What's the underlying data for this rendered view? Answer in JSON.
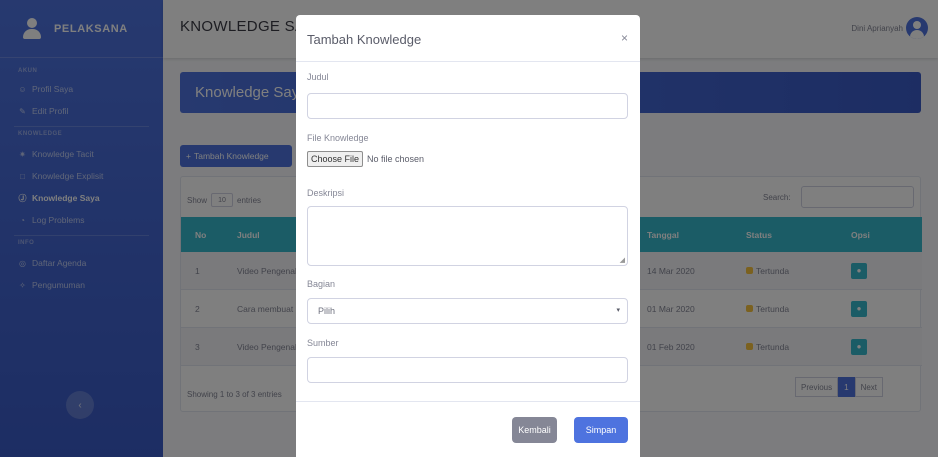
{
  "sidebar": {
    "brand": "PELAKSANA",
    "heading_1": "AKUN",
    "items_1": [
      {
        "icon": "user-icon",
        "glyph": "☺",
        "label": "Profil Saya"
      },
      {
        "icon": "edit-icon",
        "glyph": "✎",
        "label": "Edit Profil"
      }
    ],
    "heading_2": "KNOWLEDGE",
    "items_2": [
      {
        "icon": "lightbulb-icon",
        "glyph": "✷",
        "label": "Knowledge Tacit"
      },
      {
        "icon": "document-icon",
        "glyph": "□",
        "label": "Knowledge Explisit"
      },
      {
        "icon": "info-icon",
        "glyph": "Ⓙ",
        "label": "Knowledge Saya"
      },
      {
        "icon": "clock-icon",
        "glyph": "◔",
        "label": "Log Problems"
      }
    ],
    "heading_3": "INFO",
    "items_3": [
      {
        "icon": "calendar-icon",
        "glyph": "◎",
        "label": "Daftar Agenda"
      },
      {
        "icon": "megaphone-icon",
        "glyph": "✧",
        "label": "Pengumuman"
      }
    ],
    "toggle_glyph": "‹"
  },
  "topbar": {
    "title": "KNOWLEDGE SAYA",
    "user_name": "Dini Aprianyah"
  },
  "content": {
    "page_title": "Knowledge Saya",
    "add_button": "Tambah Knowledge",
    "add_icon": "+",
    "show_label": "Show",
    "show_value": "10",
    "entries_label": "entries",
    "search_label": "Search:",
    "columns": {
      "no": "No",
      "judul": "Judul",
      "tanggal": "Tanggal",
      "status": "Status",
      "opsi": "Opsi"
    },
    "rows": [
      {
        "no": "1",
        "judul": "Video Pengenalan",
        "tanggal": "14 Mar 2020",
        "status": "Tertunda"
      },
      {
        "no": "2",
        "judul": "Cara membuat",
        "tanggal": "01 Mar 2020",
        "status": "Tertunda"
      },
      {
        "no": "3",
        "judul": "Video Pengenalan",
        "tanggal": "01 Feb 2020",
        "status": "Tertunda"
      }
    ],
    "footer_info": "Showing 1 to 3 of 3 entries",
    "pager": {
      "previous": "Previous",
      "current": "1",
      "next": "Next"
    }
  },
  "modal": {
    "title": "Tambah Knowledge",
    "close": "×",
    "judul_label": "Judul",
    "file_label": "File Knowledge",
    "file_button": "Choose File",
    "file_status": "No file chosen",
    "deskripsi_label": "Deskripsi",
    "bagian_label": "Bagian",
    "bagian_value": "Pilih",
    "sumber_label": "Sumber",
    "kembali": "Kembali",
    "simpan": "Simpan"
  },
  "colors": {
    "primary": "#4e73df",
    "info": "#36b9cc",
    "warning": "#f6c23e",
    "secondary": "#858796"
  }
}
